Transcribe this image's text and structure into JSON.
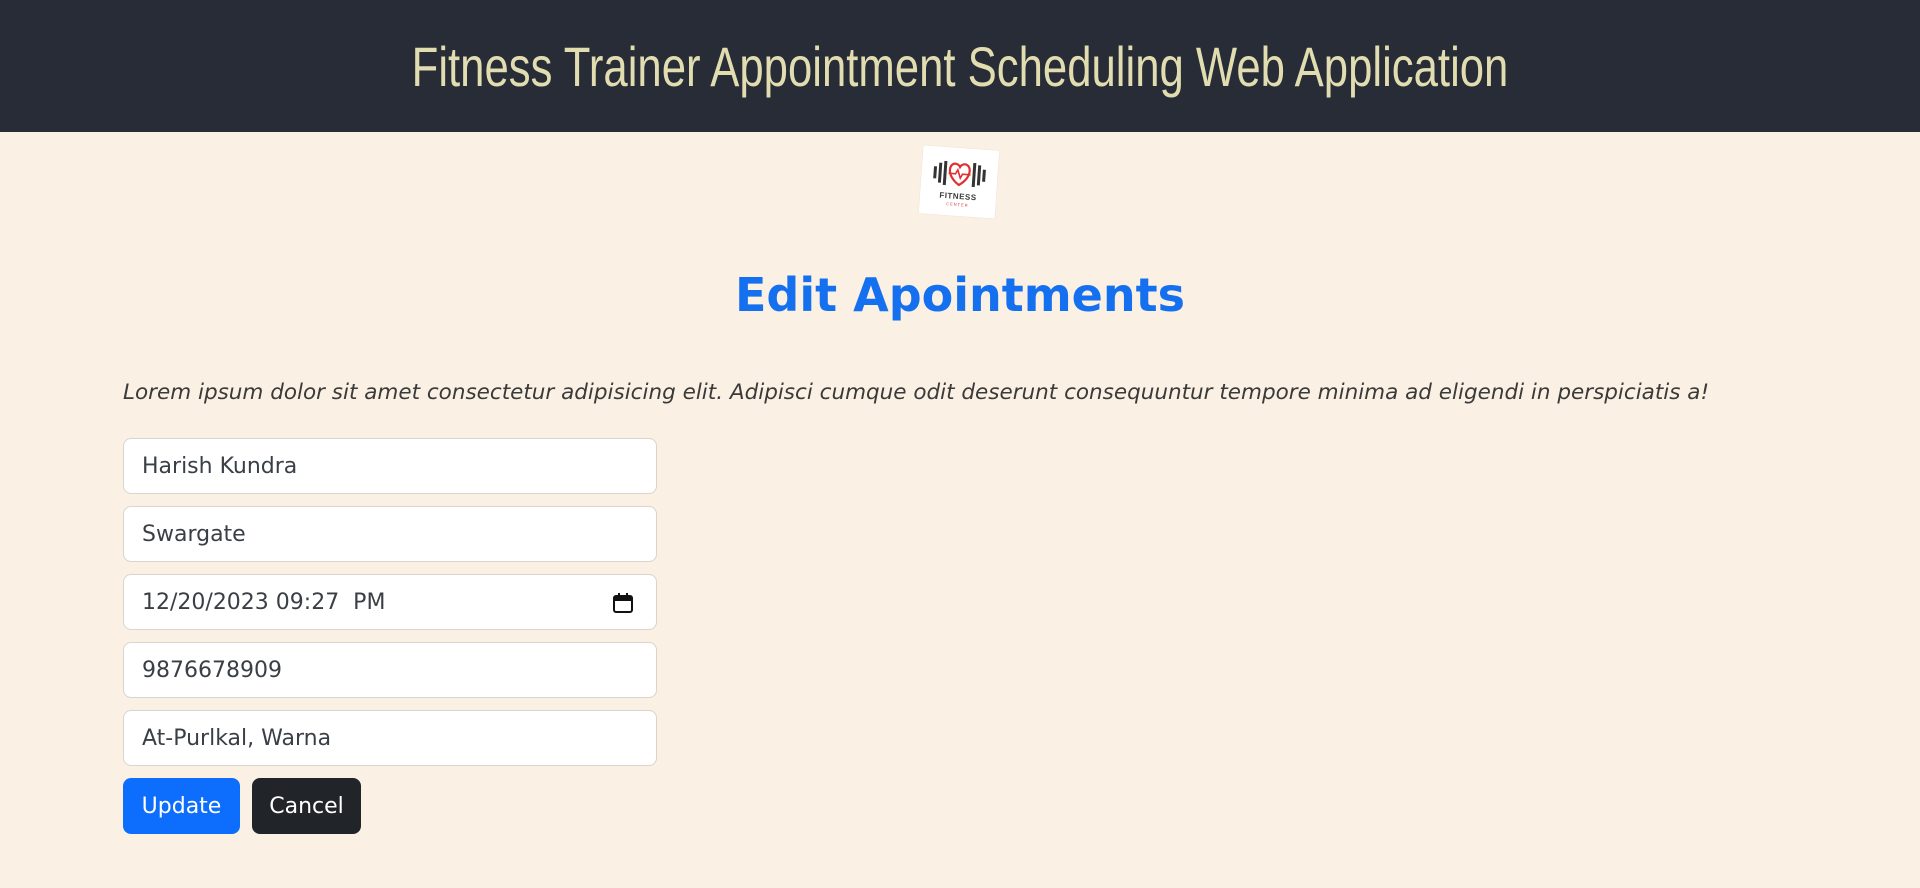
{
  "header": {
    "title": "Fitness Trainer Appointment Scheduling Web Application"
  },
  "logo": {
    "text": "FITNESS",
    "subtext": "CENTER",
    "icon": "dumbbell-heart-icon"
  },
  "page": {
    "heading": "Edit Apointments",
    "intro": "Lorem ipsum dolor sit amet consectetur adipisicing elit. Adipisci cumque odit deserunt consequuntur tempore minima ad eligendi in perspiciatis a!"
  },
  "form": {
    "name": "Harish Kundra",
    "location": "Swargate",
    "datetime": "12/20/2023 09:27  PM",
    "phone": "9876678909",
    "address": "At-Purlkal, Warna"
  },
  "buttons": {
    "update": "Update",
    "cancel": "Cancel"
  },
  "colors": {
    "header_bg": "#272c36",
    "header_text": "#e1ddb0",
    "page_bg": "#faf0e3",
    "heading": "#1570ef",
    "primary": "#0d6efd",
    "dark": "#212529"
  }
}
